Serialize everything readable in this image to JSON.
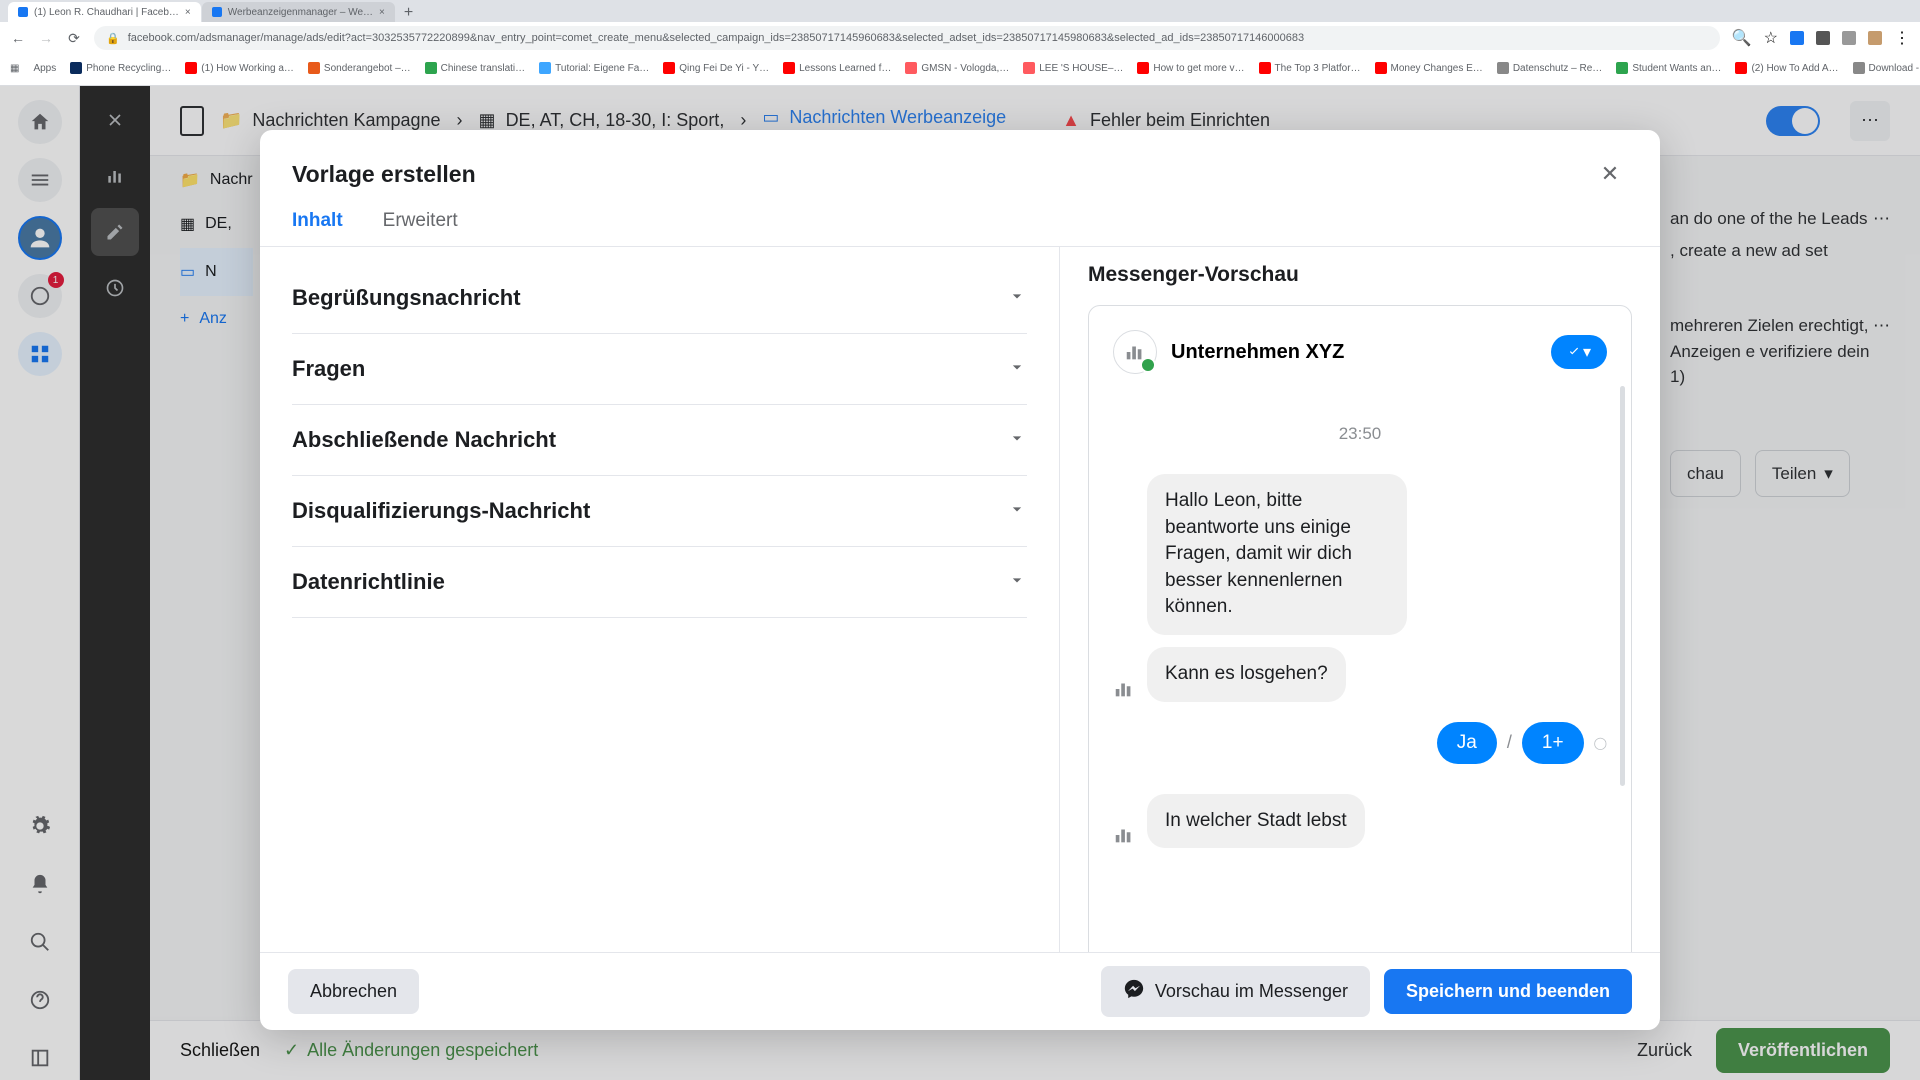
{
  "browser": {
    "tabs": [
      {
        "title": "(1) Leon R. Chaudhari | Faceb…"
      },
      {
        "title": "Werbeanzeigenmanager – We…"
      }
    ],
    "url": "facebook.com/adsmanager/manage/ads/edit?act=3032535772220899&nav_entry_point=comet_create_menu&selected_campaign_ids=23850717145960683&selected_adset_ids=23850717145980683&selected_ad_ids=23850717146000683",
    "bookmarks": [
      "Apps",
      "Phone Recycling…",
      "(1) How Working a…",
      "Sonderangebot –…",
      "Chinese translati…",
      "Tutorial: Eigene Fa…",
      "Qing Fei De Yi - Y…",
      "Lessons Learned f…",
      "GMSN - Vologda,…",
      "LEE 'S HOUSE–…",
      "How to get more v…",
      "The Top 3 Platfor…",
      "Money Changes E…",
      "Datenschutz – Re…",
      "Student Wants an…",
      "(2) How To Add A…",
      "Download - Cooki…"
    ]
  },
  "rail": {
    "badge": "1"
  },
  "breadcrumb": {
    "campaign": "Nachrichten Kampagne",
    "adset": "DE, AT, CH, 18-30, I: Sport,",
    "ad": "Nachrichten Werbeanzeige",
    "error": "Fehler beim Einrichten"
  },
  "bottomBar": {
    "close": "Schließen",
    "saved": "Alle Änderungen gespeichert",
    "back": "Zurück",
    "publish": "Veröffentlichen"
  },
  "sidePanel": {
    "text1": "an do one of the he Leads",
    "text2": ", create a new ad set",
    "text3": "mehreren Zielen erechtigt, Anzeigen e verifiziere dein 1)",
    "preview": "chau",
    "share": "Teilen"
  },
  "modal": {
    "title": "Vorlage erstellen",
    "tabs": {
      "content": "Inhalt",
      "advanced": "Erweitert"
    },
    "accordions": [
      "Begrüßungsnachricht",
      "Fragen",
      "Abschließende Nachricht",
      "Disqualifizierungs-Nachricht",
      "Datenrichtlinie"
    ],
    "preview": {
      "title": "Messenger-Vorschau",
      "company": "Unternehmen XYZ",
      "timestamp": "23:50",
      "greeting": "Hallo Leon, bitte beantworte uns einige Fragen, damit wir dich besser kennenlernen können.",
      "prompt": "Kann es losgehen?",
      "reply1": "Ja",
      "replySep": "/",
      "reply2": "1+",
      "question2": "In welcher Stadt lebst"
    },
    "footer": {
      "cancel": "Abbrechen",
      "previewBtn": "Vorschau im Messenger",
      "save": "Speichern und beenden"
    }
  }
}
